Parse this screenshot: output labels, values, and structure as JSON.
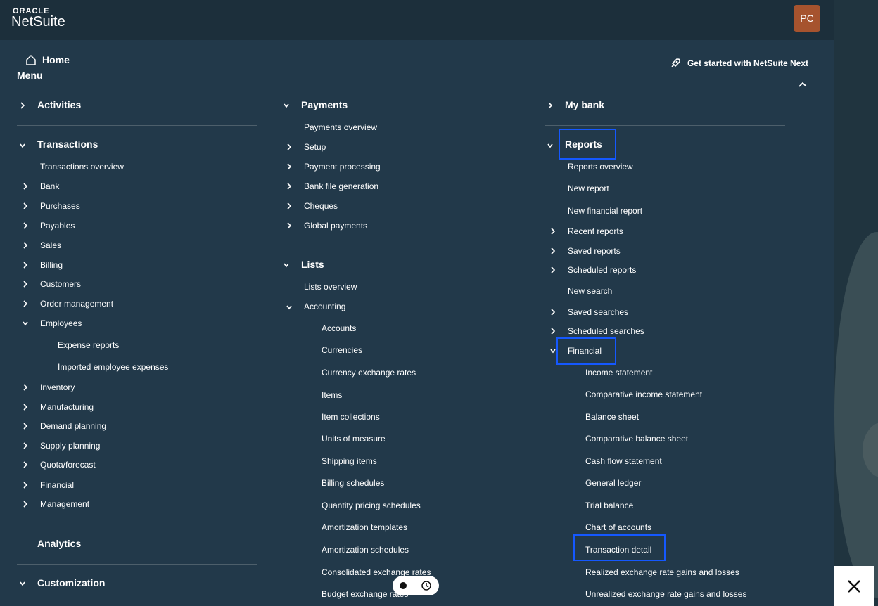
{
  "brand": {
    "top": "ORACLE",
    "name": "NetSuite"
  },
  "user": {
    "initials": "PC"
  },
  "header": {
    "home": "Home",
    "get_started": "Get started with NetSuite Next",
    "menu": "Menu"
  },
  "col1": {
    "activities": "Activities",
    "transactions": "Transactions",
    "items": [
      "Transactions overview",
      "Bank",
      "Purchases",
      "Payables",
      "Sales",
      "Billing",
      "Customers",
      "Order management",
      "Employees"
    ],
    "employee_items": [
      "Expense reports",
      "Imported employee expenses"
    ],
    "items2": [
      "Inventory",
      "Manufacturing",
      "Demand planning",
      "Supply planning",
      "Quota/forecast",
      "Financial",
      "Management"
    ],
    "analytics": "Analytics",
    "customization": "Customization"
  },
  "col2": {
    "payments": "Payments",
    "payments_items": [
      "Payments overview",
      "Setup",
      "Payment processing",
      "Bank file generation",
      "Cheques",
      "Global payments"
    ],
    "lists": "Lists",
    "lists_items": [
      "Lists overview",
      "Accounting"
    ],
    "accounting_items": [
      "Accounts",
      "Currencies",
      "Currency exchange rates",
      "Items",
      "Item collections",
      "Units of measure",
      "Shipping items",
      "Billing schedules",
      "Quantity pricing schedules",
      "Amortization templates",
      "Amortization schedules",
      "Consolidated exchange rates",
      "Budget exchange rates"
    ]
  },
  "col3": {
    "mybank": "My bank",
    "reports": "Reports",
    "reports_items": [
      "Reports overview",
      "New report",
      "New financial report",
      "Recent reports",
      "Saved reports",
      "Scheduled reports",
      "New search",
      "Saved searches",
      "Scheduled searches",
      "Financial"
    ],
    "financial_items": [
      "Income statement",
      "Comparative income statement",
      "Balance sheet",
      "Comparative balance sheet",
      "Cash flow statement",
      "General ledger",
      "Trial balance",
      "Chart of accounts",
      "Transaction detail",
      "Realized exchange rate gains and losses",
      "Unrealized exchange rate gains and losses"
    ]
  },
  "colors": {
    "highlight": "#1558ff",
    "panel": "#22394a",
    "avatar": "#a6532e"
  }
}
